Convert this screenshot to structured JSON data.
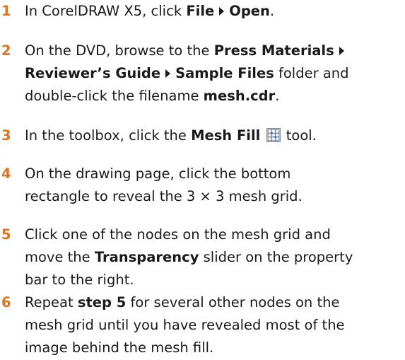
{
  "steps": [
    {
      "number": "1",
      "parts": {
        "a": "In CorelDRAW X5, click ",
        "b": "File",
        "c": "Open",
        "d": "."
      }
    },
    {
      "number": "2",
      "parts": {
        "a": "On the DVD, browse to the ",
        "b": "Press Materials",
        "c": "Reviewer’s Guide",
        "d": "Sample Files",
        "e": " folder and",
        "f": "double-click the filename ",
        "g": "mesh.cdr",
        "h": "."
      }
    },
    {
      "number": "3",
      "parts": {
        "a": "In the toolbox, click the ",
        "b": "Mesh Fill",
        "c": " tool."
      },
      "icon": "mesh-fill-icon"
    },
    {
      "number": "4",
      "lines": [
        "On the drawing page, click the bottom",
        "rectangle to reveal the 3 × 3 mesh grid."
      ]
    },
    {
      "number": "5",
      "parts": {
        "a": "Click one of the nodes on the mesh grid and",
        "b": "move the ",
        "c": "Transparency",
        "d": " slider on the property",
        "e": "bar to the right."
      }
    },
    {
      "number": "6",
      "parts": {
        "a": "Repeat ",
        "b": "step 5",
        "c": " for several other nodes on the",
        "d": "mesh grid until you have revealed most of the",
        "e": "image behind the mesh fill."
      }
    }
  ],
  "colors": {
    "step_number": "#e2711d",
    "text": "#1a1a1a"
  }
}
